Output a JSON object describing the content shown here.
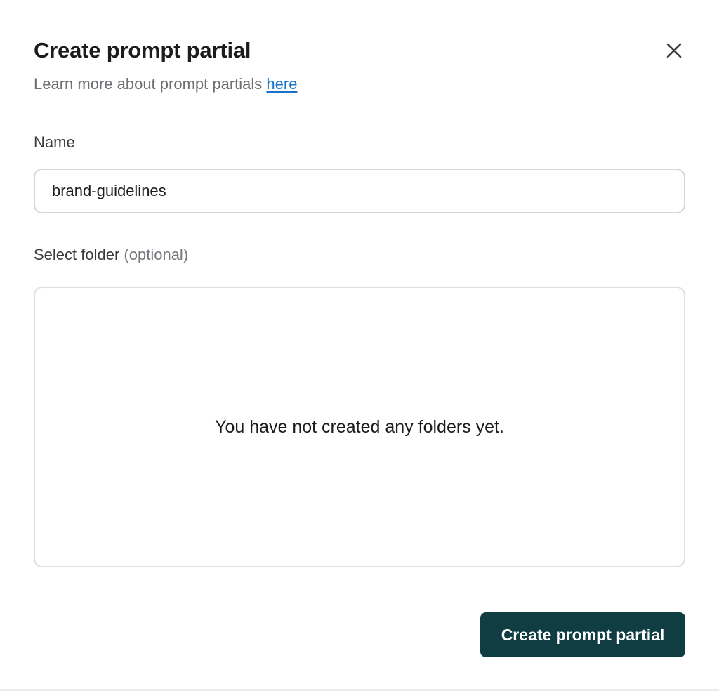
{
  "dialog": {
    "title": "Create prompt partial",
    "close_icon": "close-icon",
    "subtitle_text": "Learn more about prompt partials ",
    "subtitle_link": "here"
  },
  "name_field": {
    "label": "Name",
    "value": "brand-guidelines"
  },
  "folder_field": {
    "label": "Select folder",
    "optional": "(optional)",
    "empty_message": "You have not created any folders yet."
  },
  "actions": {
    "submit_label": "Create prompt partial"
  },
  "colors": {
    "primary_button": "#0f3d42",
    "link": "#1a73c8",
    "muted_text": "#6e6e73"
  }
}
